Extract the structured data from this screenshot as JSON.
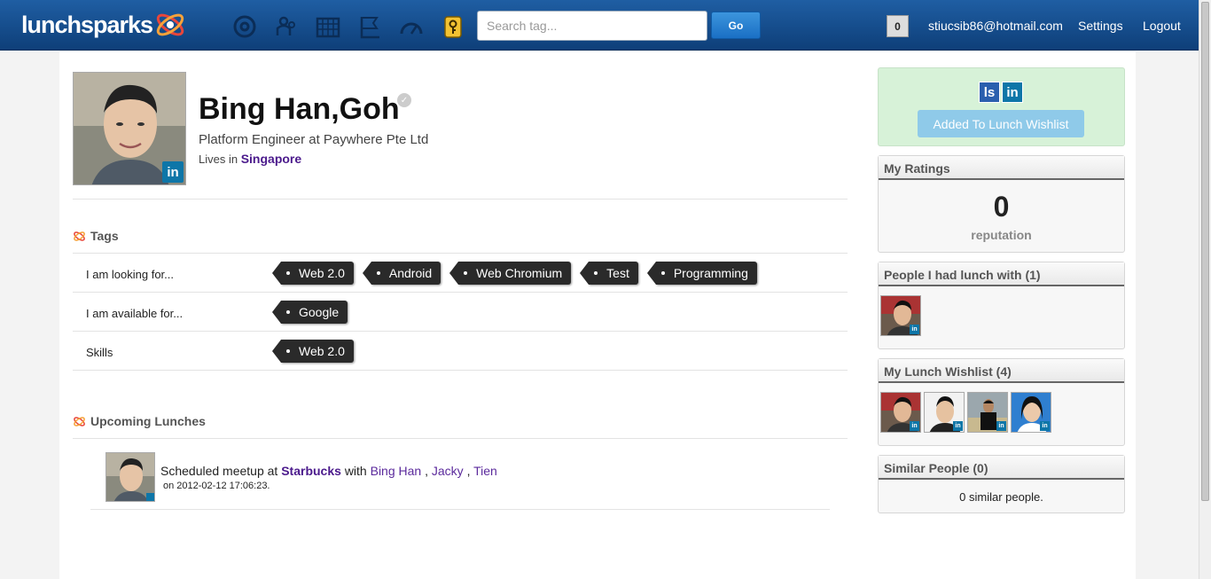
{
  "header": {
    "logo_text": "lunchsparks",
    "search_placeholder": "Search tag...",
    "go_label": "Go",
    "notification_count": "0",
    "user_email": "stiucsib86@hotmail.com",
    "settings_label": "Settings",
    "logout_label": "Logout",
    "nav_icons": [
      "home-icon",
      "people-icon",
      "calendar-icon",
      "flag-icon",
      "dashboard-icon",
      "key-icon"
    ]
  },
  "profile": {
    "name": "Bing Han,Goh",
    "headline": "Platform Engineer at Paywhere Pte Ltd",
    "lives_in_label": "Lives in",
    "location": "Singapore",
    "linkedin_badge": "in"
  },
  "tags": {
    "title": "Tags",
    "rows": [
      {
        "label": "I am looking for...",
        "tags": [
          "Web 2.0",
          "Android",
          "Web Chromium",
          "Test",
          "Programming"
        ]
      },
      {
        "label": "I am available for...",
        "tags": [
          "Google"
        ]
      },
      {
        "label": "Skills",
        "tags": [
          "Web 2.0"
        ]
      }
    ]
  },
  "lunches": {
    "title": "Upcoming Lunches",
    "items": [
      {
        "prefix": "Scheduled meetup at",
        "place": "Starbucks",
        "with_label": "with",
        "people": [
          "Bing Han",
          "Jacky",
          "Tien"
        ],
        "separator": ",",
        "date_text": "on 2012-02-12 17:06:23."
      }
    ]
  },
  "sidebar": {
    "wishlist_button": "Added To Lunch Wishlist",
    "social": [
      "ls",
      "in"
    ],
    "ratings": {
      "title": "My Ratings",
      "value": "0",
      "label": "reputation"
    },
    "lunched_with": {
      "title": "People I had lunch with (1)",
      "count": 1
    },
    "wishlist": {
      "title": "My Lunch Wishlist (4)",
      "count": 4
    },
    "similar": {
      "title": "Similar People (0)",
      "text": "0 similar people."
    }
  },
  "colors": {
    "topbar": "#1a5499",
    "tag_bg": "#2a2a2a",
    "link_purple": "#4b1a8c",
    "wishlist_box": "#d7f2d8",
    "wishlist_button": "#8fcae9",
    "linkedin": "#0e76a8"
  }
}
